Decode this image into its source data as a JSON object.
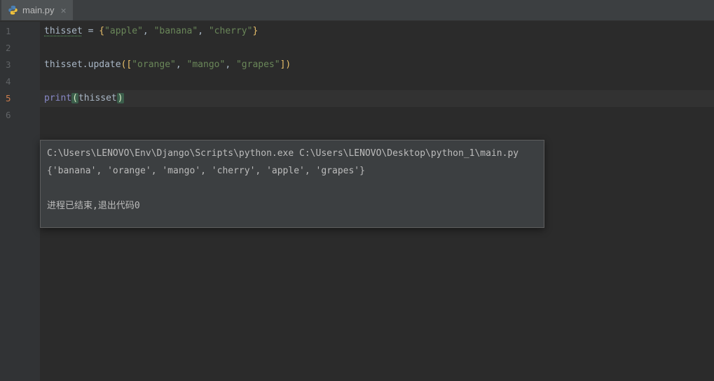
{
  "colors": {
    "editor_background": "#2b2b2b",
    "gutter_background": "#313335",
    "tabbar_background": "#3c3f41",
    "active_tab_background": "#4e5254",
    "string_color": "#6a8759",
    "brace_color": "#e8bf6a",
    "builtin_color": "#8888c6",
    "plain_code_color": "#a9b7c6",
    "current_line_highlight": "#323232"
  },
  "tab": {
    "title": "main.py",
    "close_icon": "×"
  },
  "editor": {
    "lines": [
      {
        "number": "1",
        "current": false,
        "tokens": [
          {
            "s": "typo",
            "t": "thisset"
          },
          {
            "s": "plain",
            "t": " = "
          },
          {
            "s": "brace",
            "t": "{"
          },
          {
            "s": "string",
            "t": "\"apple\""
          },
          {
            "s": "plain",
            "t": ", "
          },
          {
            "s": "string",
            "t": "\"banana\""
          },
          {
            "s": "plain",
            "t": ", "
          },
          {
            "s": "string",
            "t": "\"cherry\""
          },
          {
            "s": "brace",
            "t": "}"
          }
        ]
      },
      {
        "number": "2",
        "current": false,
        "tokens": []
      },
      {
        "number": "3",
        "current": false,
        "tokens": [
          {
            "s": "plain",
            "t": "thisset.update"
          },
          {
            "s": "brace",
            "t": "(["
          },
          {
            "s": "string",
            "t": "\"orange\""
          },
          {
            "s": "plain",
            "t": ", "
          },
          {
            "s": "string",
            "t": "\"mango\""
          },
          {
            "s": "plain",
            "t": ", "
          },
          {
            "s": "string",
            "t": "\"grapes\""
          },
          {
            "s": "brace",
            "t": "])"
          }
        ]
      },
      {
        "number": "4",
        "current": false,
        "tokens": []
      },
      {
        "number": "5",
        "current": true,
        "tokens": [
          {
            "s": "builtin",
            "t": "print"
          },
          {
            "s": "matched",
            "t": "("
          },
          {
            "s": "plain",
            "t": "thisset"
          },
          {
            "s": "matched",
            "t": ")"
          }
        ]
      },
      {
        "number": "6",
        "current": false,
        "tokens": []
      }
    ]
  },
  "output": {
    "lines": [
      "C:\\Users\\LENOVO\\Env\\Django\\Scripts\\python.exe C:\\Users\\LENOVO\\Desktop\\python_1\\main.py",
      "{'banana', 'orange', 'mango', 'cherry', 'apple', 'grapes'}",
      "",
      "进程已结束,退出代码0"
    ]
  }
}
